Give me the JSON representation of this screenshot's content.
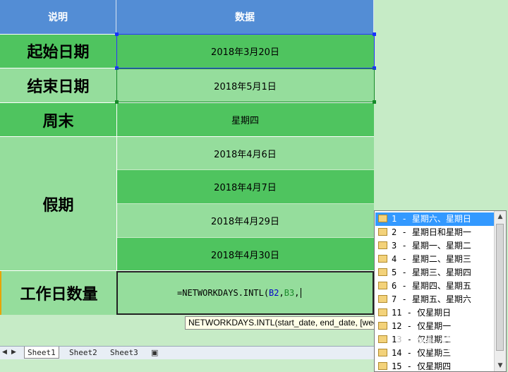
{
  "headers": {
    "col1": "说明",
    "col2": "数据"
  },
  "rows": {
    "start_label": "起始日期",
    "start_value": "2018年3月20日",
    "end_label": "结束日期",
    "end_value": "2018年5月1日",
    "weekend_label": "周末",
    "weekend_value": "星期四",
    "holiday_label": "假期",
    "holidays": [
      "2018年4月6日",
      "2018年4月7日",
      "2018年4月29日",
      "2018年4月30日"
    ],
    "workdays_label": "工作日数量"
  },
  "formula": {
    "prefix": "=NETWORKDAYS.INTL(",
    "ref1": "B2",
    "sep1": ",",
    "ref2": "B3",
    "sep2": ","
  },
  "tooltip": "NETWORKDAYS.INTL(start_date, end_date, [weekend], [holidays])",
  "sheets": [
    "Sheet1",
    "Sheet2",
    "Sheet3"
  ],
  "weekend_options": [
    "1 - 星期六、星期日",
    "2 - 星期日和星期一",
    "3 - 星期一、星期二",
    "4 - 星期二、星期三",
    "5 - 星期三、星期四",
    "6 - 星期四、星期五",
    "7 - 星期五、星期六",
    "11 - 仅星期日",
    "12 - 仅星期一",
    "13 - 仅星期二",
    "14 - 仅星期三",
    "15 - 仅星期四"
  ],
  "colors": {
    "header": "#538dd5",
    "green_dark": "#4fc45f",
    "green_light": "#95dd9c",
    "selection": "#3399ff"
  },
  "watermark": "Bai 经验"
}
